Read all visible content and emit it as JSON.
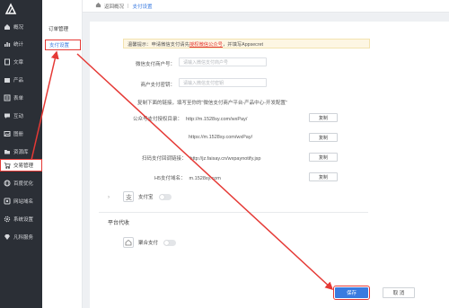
{
  "nav": {
    "items": [
      {
        "label": "概况",
        "icon": "home-icon"
      },
      {
        "label": "统计",
        "icon": "bar-chart-icon"
      },
      {
        "label": "文章",
        "icon": "document-icon"
      },
      {
        "label": "产品",
        "icon": "box-icon"
      },
      {
        "label": "表单",
        "icon": "form-icon"
      },
      {
        "label": "互动",
        "icon": "comment-icon"
      },
      {
        "label": "图册",
        "icon": "image-icon"
      },
      {
        "label": "资源库",
        "icon": "folder-icon"
      },
      {
        "label": "交易管理",
        "icon": "cart-icon"
      },
      {
        "label": "百度优化",
        "icon": "globe-icon"
      },
      {
        "label": "网站域名",
        "icon": "link-icon"
      },
      {
        "label": "系统设置",
        "icon": "gear-icon"
      },
      {
        "label": "凡科服务",
        "icon": "diamond-icon"
      }
    ]
  },
  "subnav": {
    "items": [
      "订单管理",
      "支付设置"
    ]
  },
  "breadcrumb": {
    "home": "返回概况",
    "current": "支付设置"
  },
  "notice": {
    "prefix": "温馨提示：申请微信支付请先",
    "link": "授权微信公众号",
    "suffix": "，并填写Appsecret"
  },
  "form": {
    "merchant_id_label": "微信支付商户号：",
    "merchant_id_placeholder": "请输入微信支付商户号",
    "merchant_key_label": "商户支付密钥：",
    "merchant_key_placeholder": "请输入微信支付密钥",
    "copy_tip": "复制下面的链接，填写至你的“微信支付商户平台-产品中心-开发配置”",
    "urls": [
      {
        "label": "公众号支付授权目录：",
        "value": "http://m.1528sy.com/wxPay/"
      },
      {
        "label": "",
        "value": "https://m.1528sy.com/wxPay/"
      },
      {
        "label": "扫码支付回调链接：",
        "value": "http://jz.faisay.cn/wxpaynotify.jsp"
      },
      {
        "label": "H5支付域名：",
        "value": "m.1528sy.com"
      }
    ],
    "copy_label": "复制"
  },
  "payments": [
    {
      "label": "支付宝",
      "icon": "alipay-icon",
      "enabled": false
    },
    {
      "label": "聚合支付",
      "icon": "aggregate-pay-icon",
      "enabled": false
    }
  ],
  "section_title": "平台代收",
  "actions": {
    "save": "保存",
    "cancel": "取 消"
  },
  "colors": {
    "nav_bg": "#2b2f36",
    "primary": "#3a7be0",
    "highlight": "#e53935"
  }
}
